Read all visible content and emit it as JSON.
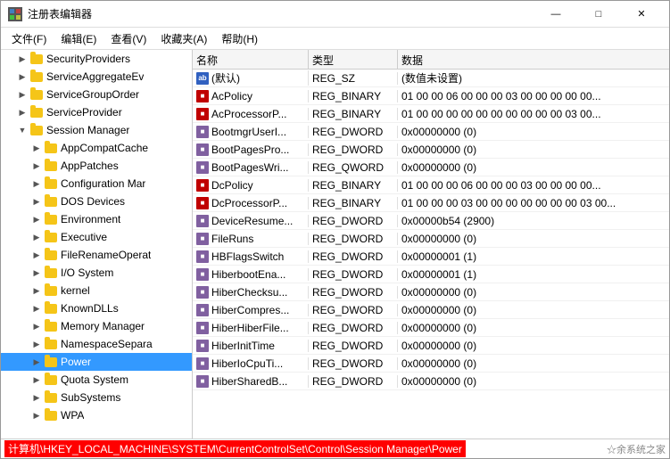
{
  "window": {
    "title": "注册表编辑器",
    "icon": "regedit-icon"
  },
  "menu": {
    "items": [
      {
        "id": "file",
        "label": "文件(F)"
      },
      {
        "id": "edit",
        "label": "编辑(E)"
      },
      {
        "id": "view",
        "label": "查看(V)"
      },
      {
        "id": "favorites",
        "label": "收藏夹(A)"
      },
      {
        "id": "help",
        "label": "帮助(H)"
      }
    ]
  },
  "tree": {
    "items": [
      {
        "id": "security-providers",
        "label": "SecurityProviders",
        "indent": 1,
        "expanded": false,
        "selected": false
      },
      {
        "id": "service-aggregate-ev",
        "label": "ServiceAggregateEv",
        "indent": 1,
        "expanded": false,
        "selected": false
      },
      {
        "id": "service-group-order",
        "label": "ServiceGroupOrder",
        "indent": 1,
        "expanded": false,
        "selected": false
      },
      {
        "id": "service-provider",
        "label": "ServiceProvider",
        "indent": 1,
        "expanded": false,
        "selected": false
      },
      {
        "id": "session-manager",
        "label": "Session Manager",
        "indent": 1,
        "expanded": true,
        "selected": false
      },
      {
        "id": "app-compat-cache",
        "label": "AppCompatCache",
        "indent": 2,
        "expanded": false,
        "selected": false
      },
      {
        "id": "app-patches",
        "label": "AppPatches",
        "indent": 2,
        "expanded": false,
        "selected": false
      },
      {
        "id": "configuration-mar",
        "label": "Configuration Mar",
        "indent": 2,
        "expanded": false,
        "selected": false
      },
      {
        "id": "dos-devices",
        "label": "DOS Devices",
        "indent": 2,
        "expanded": false,
        "selected": false
      },
      {
        "id": "environment",
        "label": "Environment",
        "indent": 2,
        "expanded": false,
        "selected": false
      },
      {
        "id": "executive",
        "label": "Executive",
        "indent": 2,
        "expanded": false,
        "selected": false
      },
      {
        "id": "file-rename-operat",
        "label": "FileRenameOperat",
        "indent": 2,
        "expanded": false,
        "selected": false
      },
      {
        "id": "io-system",
        "label": "I/O System",
        "indent": 2,
        "expanded": false,
        "selected": false
      },
      {
        "id": "kernel",
        "label": "kernel",
        "indent": 2,
        "expanded": false,
        "selected": false
      },
      {
        "id": "known-dlls",
        "label": "KnownDLLs",
        "indent": 2,
        "expanded": false,
        "selected": false
      },
      {
        "id": "memory-manager",
        "label": "Memory Manager",
        "indent": 2,
        "expanded": false,
        "selected": false
      },
      {
        "id": "namespace-separa",
        "label": "NamespaceSepara",
        "indent": 2,
        "expanded": false,
        "selected": false
      },
      {
        "id": "power",
        "label": "Power",
        "indent": 2,
        "expanded": false,
        "selected": true
      },
      {
        "id": "quota-system",
        "label": "Quota System",
        "indent": 2,
        "expanded": false,
        "selected": false
      },
      {
        "id": "sub-systems",
        "label": "SubSystems",
        "indent": 2,
        "expanded": false,
        "selected": false
      },
      {
        "id": "wpa",
        "label": "WPA",
        "indent": 2,
        "expanded": false,
        "selected": false
      }
    ]
  },
  "columns": {
    "name": "名称",
    "type": "类型",
    "data": "数据"
  },
  "values": [
    {
      "id": "default",
      "name": "(默认)",
      "icon": "ab",
      "type": "REG_SZ",
      "data": "(数值未设置)"
    },
    {
      "id": "acpolicy",
      "name": "AcPolicy",
      "icon": "bin",
      "type": "REG_BINARY",
      "data": "01 00 00 06 00 00 00 03 00 00 00 00 00..."
    },
    {
      "id": "acprocessorp",
      "name": "AcProcessorP...",
      "icon": "bin",
      "type": "REG_BINARY",
      "data": "01 00 00 00 00 00 00 00 00 00 00 03 00..."
    },
    {
      "id": "bootmgruser1",
      "name": "BootmgrUserI...",
      "icon": "dword",
      "type": "REG_DWORD",
      "data": "0x00000000 (0)"
    },
    {
      "id": "bootpagespro",
      "name": "BootPagesPro...",
      "icon": "dword",
      "type": "REG_DWORD",
      "data": "0x00000000 (0)"
    },
    {
      "id": "bootpageswri",
      "name": "BootPagesWri...",
      "icon": "dword",
      "type": "REG_QWORD",
      "data": "0x00000000 (0)"
    },
    {
      "id": "dcpolicy",
      "name": "DcPolicy",
      "icon": "bin",
      "type": "REG_BINARY",
      "data": "01 00 00 00 06 00 00 00 03 00 00 00 00..."
    },
    {
      "id": "dcprocessorp",
      "name": "DcProcessorP...",
      "icon": "bin",
      "type": "REG_BINARY",
      "data": "01 00 00 00 03 00 00 00 00 00 00 00 03 00..."
    },
    {
      "id": "deviceresume",
      "name": "DeviceResume...",
      "icon": "dword",
      "type": "REG_DWORD",
      "data": "0x00000b54 (2900)"
    },
    {
      "id": "fileruns",
      "name": "FileRuns",
      "icon": "dword",
      "type": "REG_DWORD",
      "data": "0x00000000 (0)"
    },
    {
      "id": "hbflagsswitch",
      "name": "HBFlagsSwitch",
      "icon": "dword",
      "type": "REG_DWORD",
      "data": "0x00000001 (1)"
    },
    {
      "id": "hiberbootena",
      "name": "HiberbootEna...",
      "icon": "dword",
      "type": "REG_DWORD",
      "data": "0x00000001 (1)"
    },
    {
      "id": "hiберchecksu",
      "name": "HiberChecksu...",
      "icon": "dword",
      "type": "REG_DWORD",
      "data": "0x00000000 (0)"
    },
    {
      "id": "hibercompres",
      "name": "HiberCompres...",
      "icon": "dword",
      "type": "REG_DWORD",
      "data": "0x00000000 (0)"
    },
    {
      "id": "hiberhiberfile",
      "name": "HiberHiberFile...",
      "icon": "dword",
      "type": "REG_DWORD",
      "data": "0x00000000 (0)"
    },
    {
      "id": "hiberinittime",
      "name": "HiberInitTime",
      "icon": "dword",
      "type": "REG_DWORD",
      "data": "0x00000000 (0)"
    },
    {
      "id": "hiberlocputil",
      "name": "HiberIoCpuTi...",
      "icon": "dword",
      "type": "REG_DWORD",
      "data": "0x00000000 (0)"
    },
    {
      "id": "hibersharedb",
      "name": "HiberSharedB...",
      "icon": "dword",
      "type": "REG_DWORD",
      "data": "0x00000000 (0)"
    }
  ],
  "status": {
    "path": "计算机\\HKEY_LOCAL_MACHINE\\SYSTEM\\CurrentControlSet\\Control\\Session Manager\\Power",
    "logo": "☆余系统之家"
  }
}
